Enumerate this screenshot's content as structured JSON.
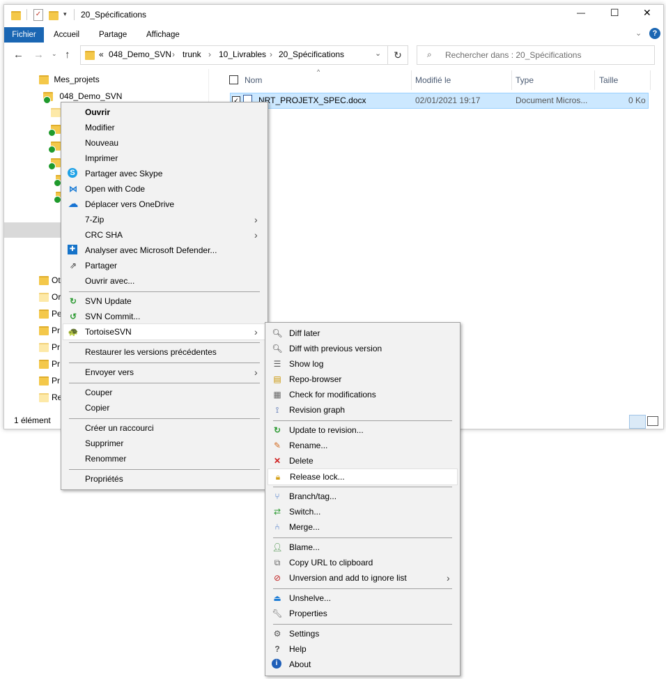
{
  "window": {
    "title": "20_Spécifications",
    "controls": {
      "minimize": "—",
      "maximize": "☐",
      "close": "✕"
    }
  },
  "ribbon": {
    "tabs": [
      "Fichier",
      "Accueil",
      "Partage",
      "Affichage"
    ]
  },
  "address": {
    "prefix": "«",
    "crumbs": [
      "048_Demo_SVN",
      "trunk",
      "10_Livrables",
      "20_Spécifications"
    ],
    "separator": "›"
  },
  "search": {
    "placeholder": "Rechercher dans : 20_Spécifications"
  },
  "nav_tree": {
    "items": [
      "Mes_projets",
      "048_Demo_SVN"
    ],
    "partial_items": [
      "Ot",
      "Or",
      "Pe",
      "Pr",
      "Pr",
      "Pr",
      "Pr",
      "Re"
    ]
  },
  "columns": {
    "name": "Nom",
    "modified": "Modifié le",
    "type": "Type",
    "size": "Taille"
  },
  "files": [
    {
      "name": "NRT_PROJETX_SPEC.docx",
      "modified": "02/01/2021 19:17",
      "type": "Document Micros...",
      "size": "0 Ko"
    }
  ],
  "status": {
    "count": "1 élément"
  },
  "context_menu": {
    "groups": [
      [
        "Ouvrir",
        "Modifier",
        "Nouveau",
        "Imprimer",
        "Partager avec Skype",
        "Open with Code",
        "Déplacer vers OneDrive",
        "7-Zip",
        "CRC SHA",
        "Analyser avec Microsoft Defender...",
        "Partager",
        "Ouvrir avec..."
      ],
      [
        "SVN Update",
        "SVN Commit...",
        "TortoiseSVN"
      ],
      [
        "Restaurer les versions précédentes"
      ],
      [
        "Envoyer vers"
      ],
      [
        "Couper",
        "Copier"
      ],
      [
        "Créer un raccourci",
        "Supprimer",
        "Renommer"
      ],
      [
        "Propriétés"
      ]
    ]
  },
  "tortoise_menu": {
    "groups": [
      [
        "Diff later",
        "Diff with previous version",
        "Show log",
        "Repo-browser",
        "Check for modifications",
        "Revision graph"
      ],
      [
        "Update to revision...",
        "Rename...",
        "Delete",
        "Release lock..."
      ],
      [
        "Branch/tag...",
        "Switch...",
        "Merge..."
      ],
      [
        "Blame...",
        "Copy URL to clipboard",
        "Unversion and add to ignore list"
      ],
      [
        "Unshelve...",
        "Properties"
      ],
      [
        "Settings",
        "Help",
        "About"
      ]
    ]
  },
  "colors": {
    "accent": "#1a66b3",
    "selection": "#cce8ff",
    "menu_bg": "#f2f2f2"
  }
}
